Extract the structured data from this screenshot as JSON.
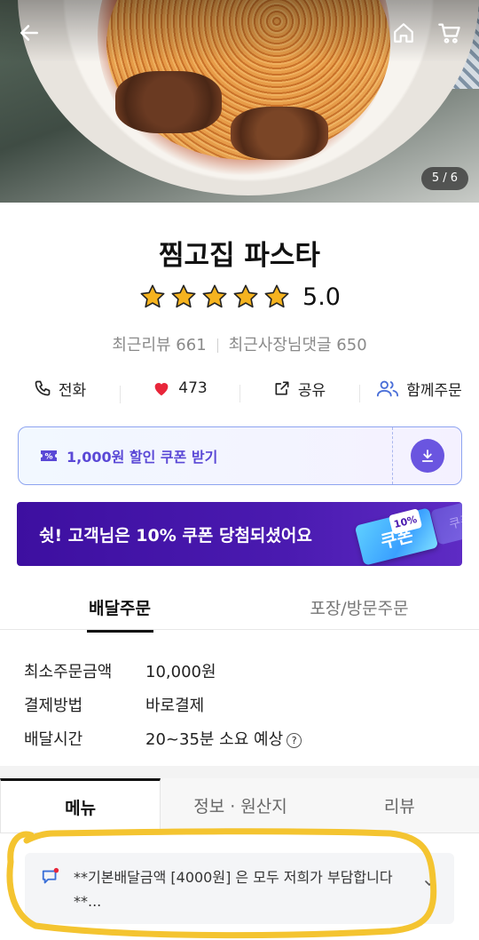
{
  "hero": {
    "counter": "5 / 6"
  },
  "store": {
    "name": "찜고집 파스타",
    "rating": "5.0",
    "stars": 5
  },
  "meta": {
    "reviews": "최근리뷰 661",
    "owner_replies": "최근사장님댓글 650"
  },
  "actions": [
    {
      "label": "전화",
      "icon": "phone-icon"
    },
    {
      "label": "473",
      "icon": "heart-icon"
    },
    {
      "label": "공유",
      "icon": "share-icon"
    },
    {
      "label": "함께주문",
      "icon": "group-order-icon"
    }
  ],
  "coupon": {
    "label": "1,000원 할인 쿠폰 받기"
  },
  "banner": {
    "text": "쉿! 고객님은 10% 쿠폰 당첨되셨어요",
    "ticket": "쿠폰",
    "badge": "10%"
  },
  "order_tabs": {
    "delivery": "배달주문",
    "pickup": "포장/방문주문"
  },
  "info": [
    {
      "key": "최소주문금액",
      "value": "10,000원"
    },
    {
      "key": "결제방법",
      "value": "바로결제"
    },
    {
      "key": "배달시간",
      "value": "20~35분 소요 예상"
    }
  ],
  "menu_tabs": {
    "menu": "메뉴",
    "info": "정보 · 원산지",
    "review": "리뷰"
  },
  "notice": {
    "text": "**기본배달금액 [4000원] 은 모두 저희가 부담합니다**..."
  },
  "colors": {
    "accent": "#6a55e0",
    "banner": "#3d0fa0",
    "star": "#f5b31f",
    "heart": "#e8263a",
    "highlight": "#f4c430"
  }
}
